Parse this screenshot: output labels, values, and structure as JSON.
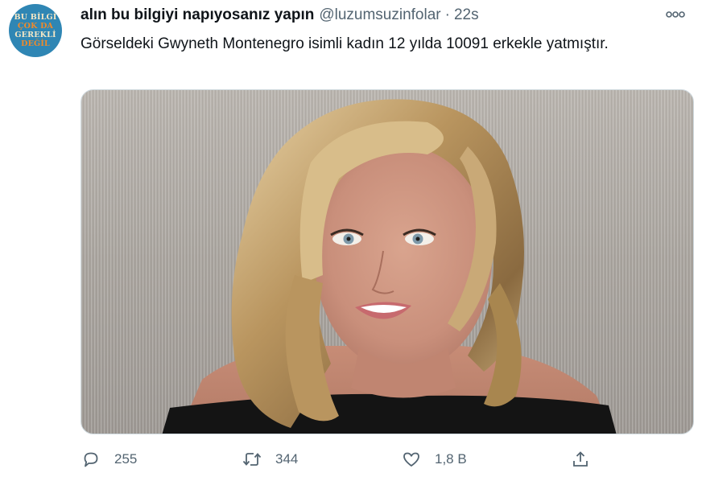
{
  "tweet": {
    "avatar": {
      "lines": [
        "BU BİLGİ",
        "ÇOK DA",
        "GEREKLİ",
        "DEĞİL"
      ],
      "background": "#2f86b4"
    },
    "author_name": "alın bu bilgiyi napıyosanız yapın",
    "handle": "@luzumsuzinfolar",
    "separator": "·",
    "time": "22s",
    "text": "Görseldeki Gwyneth Montenegro isimli kadın 12 yılda 10091 erkekle yatmıştır.",
    "more_icon": "ellipsis-icon"
  },
  "actions": {
    "reply": {
      "icon": "reply-icon",
      "count": "255"
    },
    "retweet": {
      "icon": "retweet-icon",
      "count": "344"
    },
    "like": {
      "icon": "heart-icon",
      "count": "1,8 B"
    },
    "share": {
      "icon": "share-icon"
    }
  }
}
